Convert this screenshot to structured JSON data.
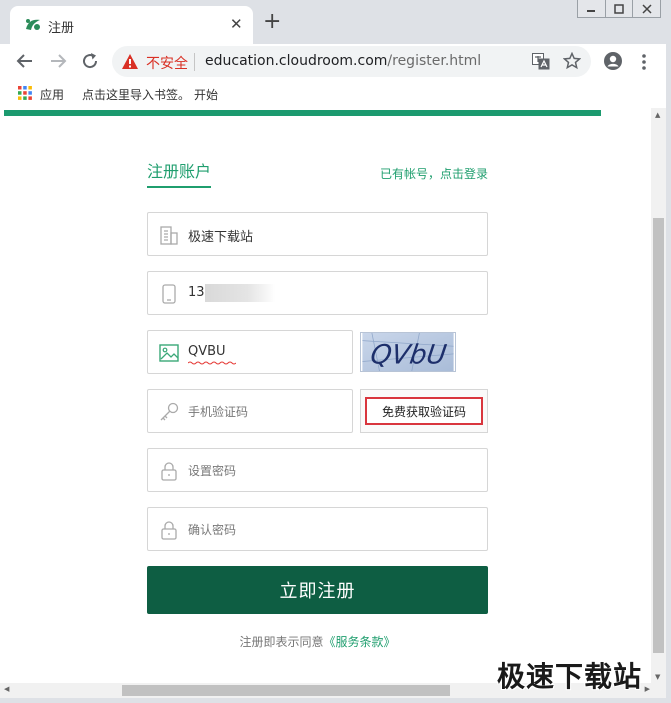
{
  "browser": {
    "tab_title": "注册",
    "new_tab_symbol": "+",
    "close_tab_symbol": "✕",
    "security_label": "不安全",
    "url_host": "education.cloudroom.com",
    "url_path": "/register.html",
    "bookmarks": {
      "apps": "应用",
      "import": "点击这里导入书签。",
      "start": "开始"
    }
  },
  "form": {
    "title": "注册账户",
    "login_link": "已有帐号，点击登录",
    "company": {
      "value": "极速下载站",
      "icon": "building-icon"
    },
    "phone": {
      "value": "13",
      "icon": "phone-icon"
    },
    "captcha": {
      "value": "QVBU",
      "image_text": "QVbU",
      "icon": "image-icon"
    },
    "sms_code": {
      "placeholder": "手机验证码",
      "icon": "key-icon"
    },
    "sms_button": "免费获取验证码",
    "password": {
      "placeholder": "设置密码",
      "icon": "lock-icon"
    },
    "confirm_password": {
      "placeholder": "确认密码",
      "icon": "lock-icon"
    },
    "submit": "立即注册",
    "agreement_prefix": "注册即表示同意",
    "agreement_terms": "《服务条款》"
  },
  "watermark": "极速下载站",
  "colors": {
    "accent": "#1f9e6e",
    "submit_bg": "#0e5e43",
    "warning": "#d93025",
    "highlight_box": "#d9363e"
  }
}
